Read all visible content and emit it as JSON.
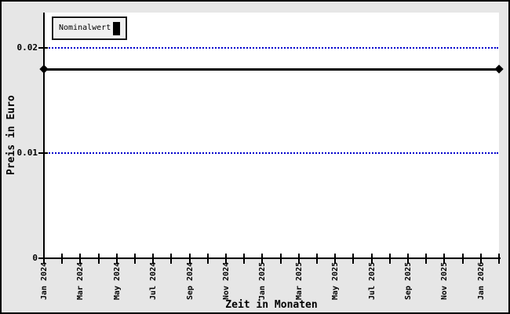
{
  "chart_data": {
    "type": "line",
    "title": "",
    "xlabel": "Zeit in Monaten",
    "ylabel": "Preis in Euro",
    "legend": {
      "label": "Nominalwert",
      "position": "top-left",
      "swatch_color": "#000000"
    },
    "series": [
      {
        "name": "Nominalwert",
        "color": "#000000",
        "marker": "diamond",
        "x": [
          "Jan 2024",
          "Feb 2026"
        ],
        "values": [
          0.018,
          0.018
        ]
      }
    ],
    "x_tick_labels": [
      "Jan 2024",
      "Mar 2024",
      "May 2024",
      "Jul 2024",
      "Sep 2024",
      "Nov 2024",
      "Jan 2025",
      "Mar 2025",
      "May 2025",
      "Jul 2025",
      "Sep 2025",
      "Nov 2025",
      "Jan 2026"
    ],
    "x_minor_tick_count": 26,
    "x_months_span": 25,
    "y_ticks": [
      {
        "label": "0",
        "value": 0
      },
      {
        "label": "0.01",
        "value": 0.01
      },
      {
        "label": "0.02",
        "value": 0.02
      }
    ],
    "ylim": [
      0,
      0.0234
    ],
    "y_gridlines": [
      0.01,
      0.02
    ],
    "grid": {
      "color": "#0000cc",
      "style": "dotted"
    },
    "colors": {
      "background": "#e6e6e6",
      "plot_background": "#ffffff",
      "axis": "#000000",
      "series_line": "#000000",
      "legend_background": "#f0f0f0"
    }
  }
}
